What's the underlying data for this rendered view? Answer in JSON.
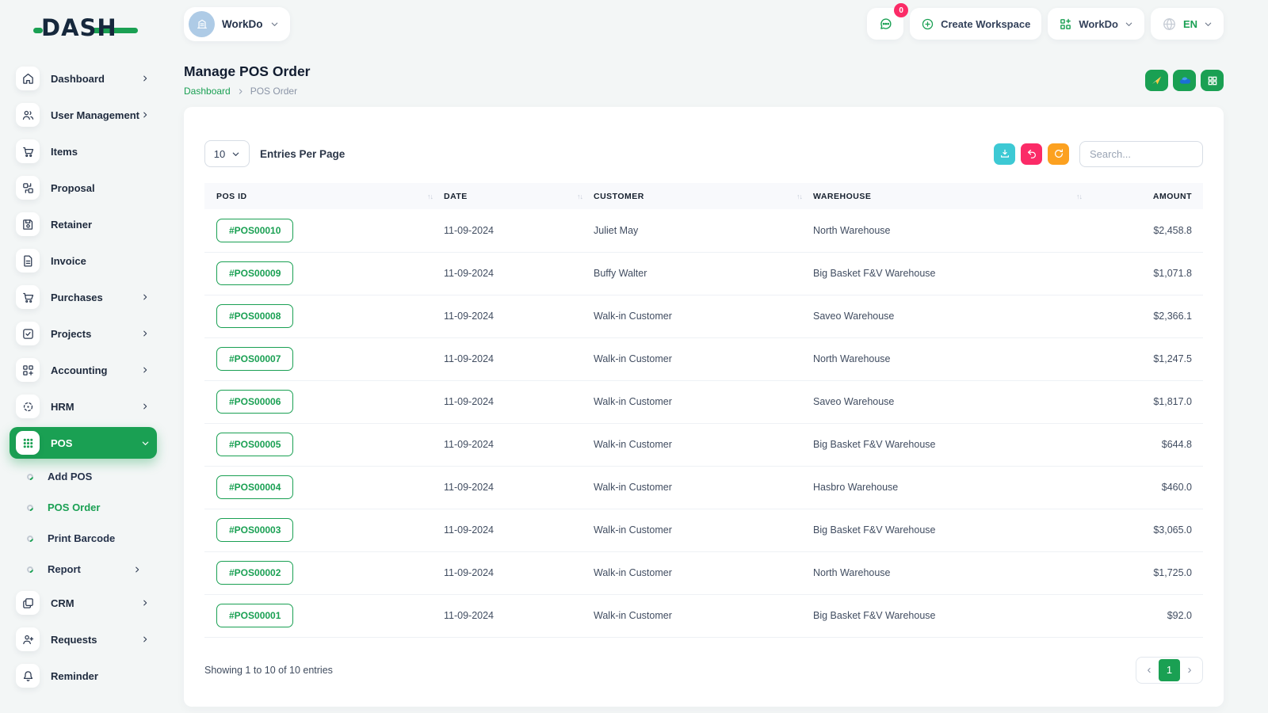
{
  "brand": {
    "name": "DASH"
  },
  "topbar": {
    "workspace": {
      "label": "WorkDo"
    },
    "messages": {
      "badge": "0"
    },
    "create_workspace": {
      "label": "Create Workspace"
    },
    "workspace_menu": {
      "label": "WorkDo"
    },
    "language": {
      "label": "EN"
    }
  },
  "sidebar": {
    "items": [
      {
        "label": "Dashboard"
      },
      {
        "label": "User Management"
      },
      {
        "label": "Items"
      },
      {
        "label": "Proposal"
      },
      {
        "label": "Retainer"
      },
      {
        "label": "Invoice"
      },
      {
        "label": "Purchases"
      },
      {
        "label": "Projects"
      },
      {
        "label": "Accounting"
      },
      {
        "label": "HRM"
      },
      {
        "label": "POS"
      },
      {
        "label": "CRM"
      },
      {
        "label": "Requests"
      },
      {
        "label": "Reminder"
      }
    ],
    "pos_submenu": [
      {
        "label": "Add POS"
      },
      {
        "label": "POS Order"
      },
      {
        "label": "Print Barcode"
      },
      {
        "label": "Report"
      }
    ]
  },
  "page": {
    "title": "Manage POS Order",
    "breadcrumb": {
      "home": "Dashboard",
      "current": "POS Order"
    }
  },
  "toolbar": {
    "entries_value": "10",
    "entries_label": "Entries Per Page",
    "search_placeholder": "Search..."
  },
  "table": {
    "columns": [
      "POS ID",
      "DATE",
      "CUSTOMER",
      "WAREHOUSE",
      "AMOUNT"
    ],
    "rows": [
      {
        "pos_id": "#POS00010",
        "date": "11-09-2024",
        "customer": "Juliet May",
        "warehouse": "North Warehouse",
        "amount": "$2,458.8"
      },
      {
        "pos_id": "#POS00009",
        "date": "11-09-2024",
        "customer": "Buffy Walter",
        "warehouse": "Big Basket F&V Warehouse",
        "amount": "$1,071.8"
      },
      {
        "pos_id": "#POS00008",
        "date": "11-09-2024",
        "customer": "Walk-in Customer",
        "warehouse": "Saveo Warehouse",
        "amount": "$2,366.1"
      },
      {
        "pos_id": "#POS00007",
        "date": "11-09-2024",
        "customer": "Walk-in Customer",
        "warehouse": "North Warehouse",
        "amount": "$1,247.5"
      },
      {
        "pos_id": "#POS00006",
        "date": "11-09-2024",
        "customer": "Walk-in Customer",
        "warehouse": "Saveo Warehouse",
        "amount": "$1,817.0"
      },
      {
        "pos_id": "#POS00005",
        "date": "11-09-2024",
        "customer": "Walk-in Customer",
        "warehouse": "Big Basket F&V Warehouse",
        "amount": "$644.8"
      },
      {
        "pos_id": "#POS00004",
        "date": "11-09-2024",
        "customer": "Walk-in Customer",
        "warehouse": "Hasbro Warehouse",
        "amount": "$460.0"
      },
      {
        "pos_id": "#POS00003",
        "date": "11-09-2024",
        "customer": "Walk-in Customer",
        "warehouse": "Big Basket F&V Warehouse",
        "amount": "$3,065.0"
      },
      {
        "pos_id": "#POS00002",
        "date": "11-09-2024",
        "customer": "Walk-in Customer",
        "warehouse": "North Warehouse",
        "amount": "$1,725.0"
      },
      {
        "pos_id": "#POS00001",
        "date": "11-09-2024",
        "customer": "Walk-in Customer",
        "warehouse": "Big Basket F&V Warehouse",
        "amount": "$92.0"
      }
    ],
    "summary": "Showing 1 to 10 of 10 entries",
    "page_number": "1"
  },
  "icons": {
    "sort": "↑↓",
    "prev": "‹",
    "next": "›"
  },
  "colors": {
    "primary_green": "#1aa053",
    "info_cyan": "#3dc9d4",
    "danger_pink": "#fb2b67",
    "warning_orange": "#fca120",
    "navy_text": "#16283c",
    "background": "#f3f6f6"
  }
}
